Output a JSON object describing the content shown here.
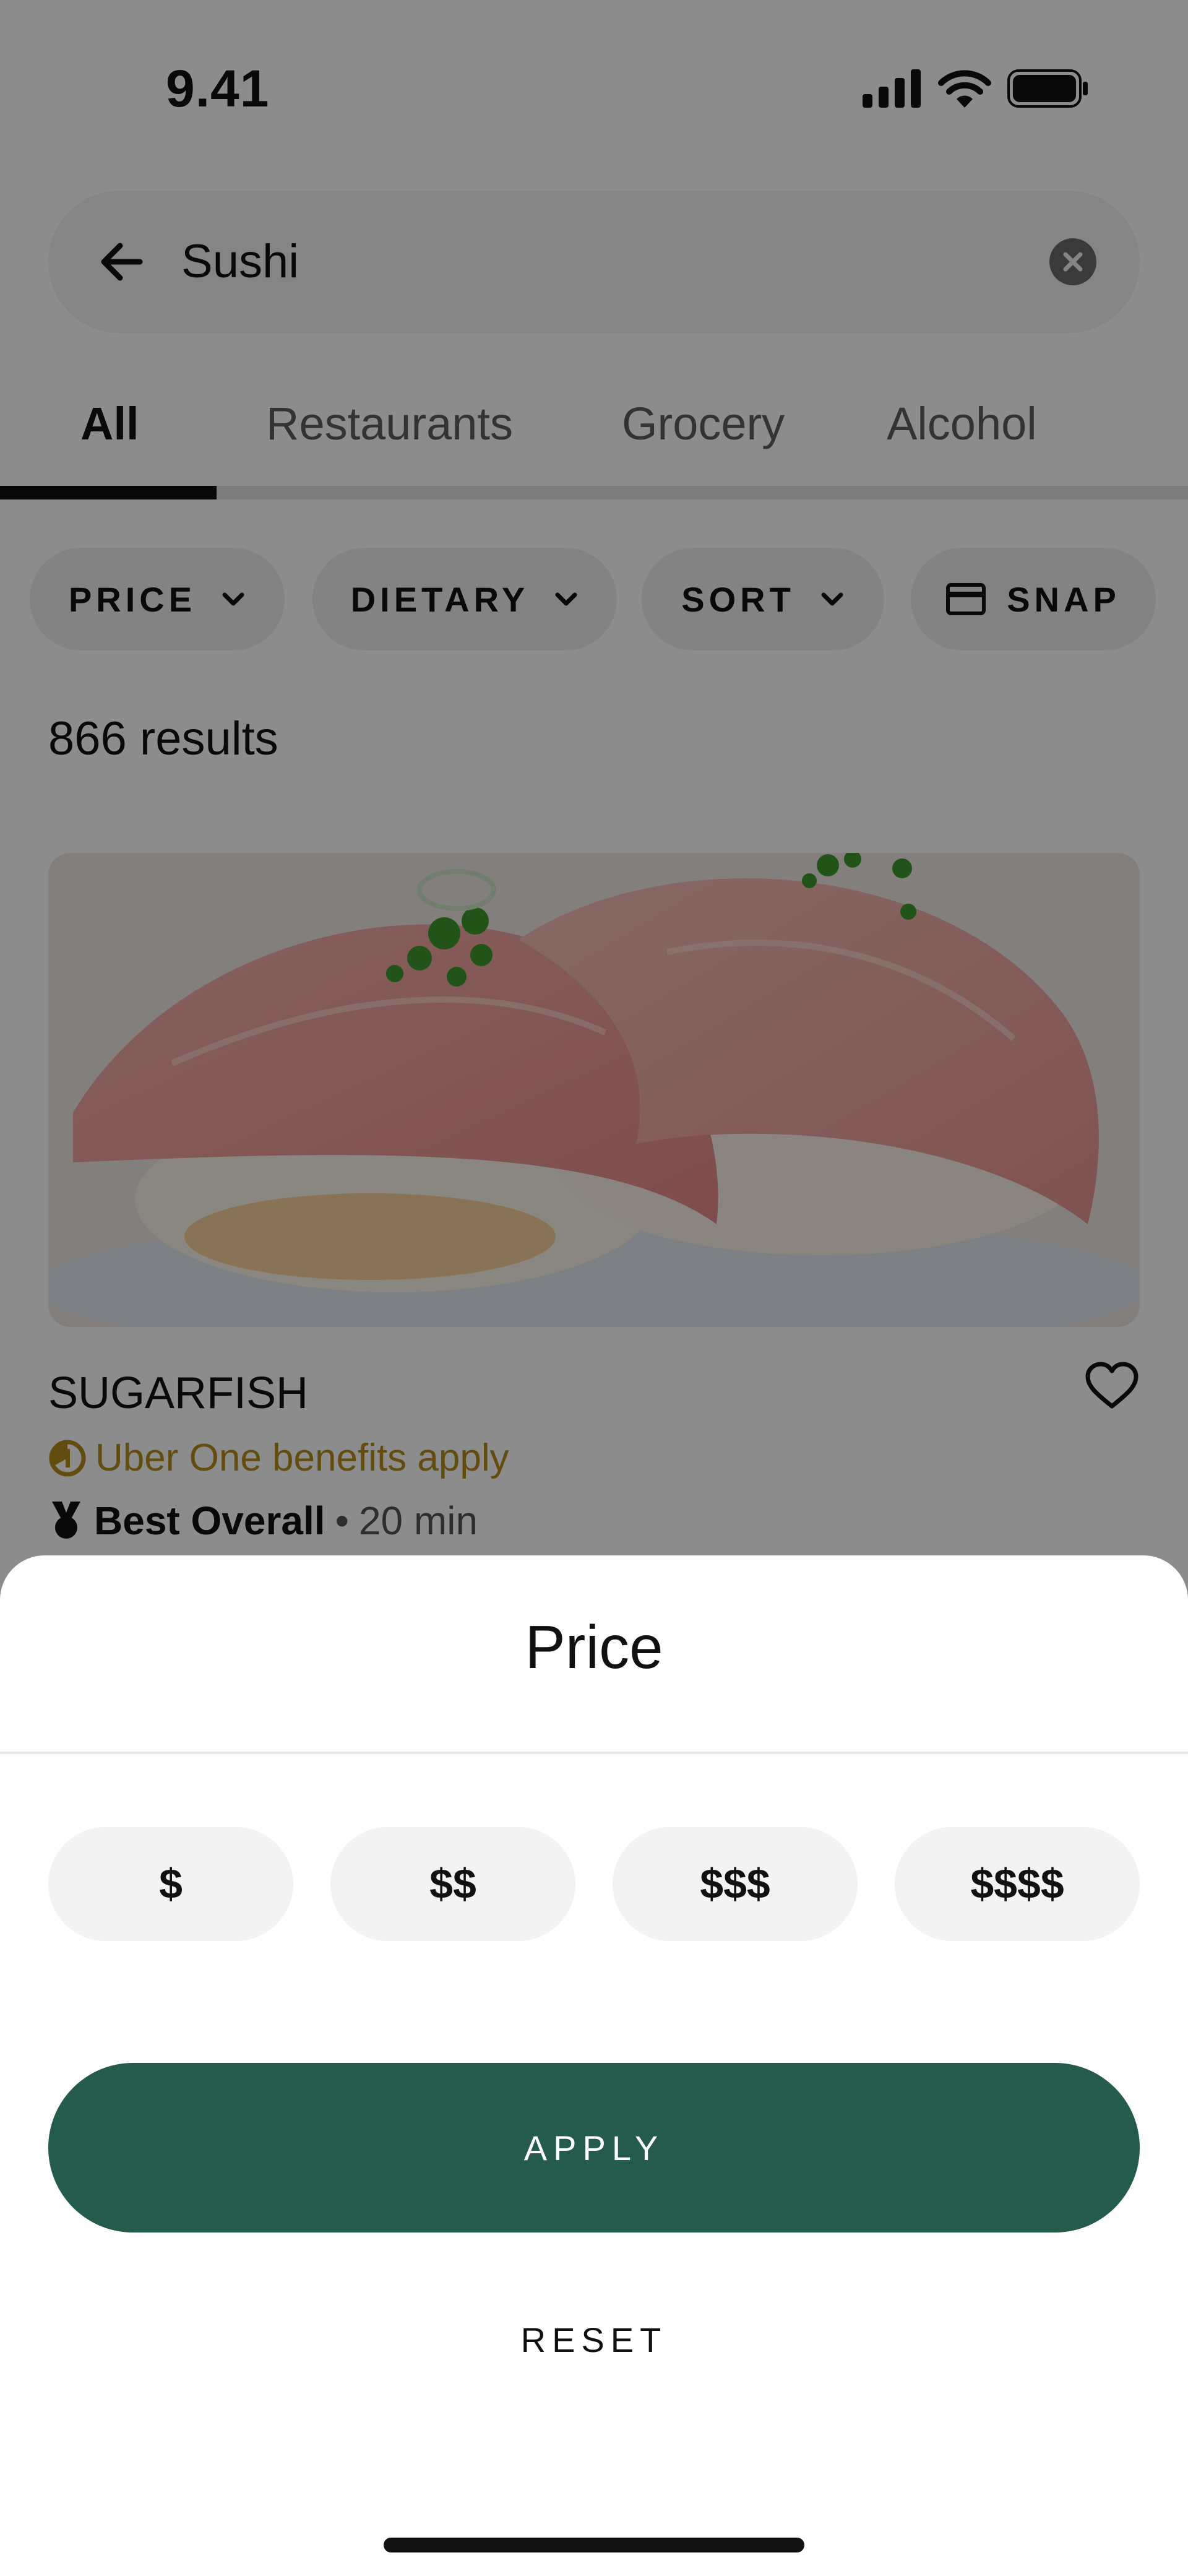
{
  "status_bar": {
    "time": "9.41",
    "icons": [
      "signal-icon",
      "wifi-icon",
      "battery-icon"
    ]
  },
  "search": {
    "query": "Sushi",
    "back_icon": "arrow-left-icon",
    "clear_icon": "clear-icon"
  },
  "tabs": [
    {
      "label": "All",
      "active": true
    },
    {
      "label": "Restaurants",
      "active": false
    },
    {
      "label": "Grocery",
      "active": false
    },
    {
      "label": "Alcohol",
      "active": false
    }
  ],
  "filters": [
    {
      "label": "PRICE",
      "icon": "chevron-down-icon"
    },
    {
      "label": "DIETARY",
      "icon": "chevron-down-icon"
    },
    {
      "label": "SORT",
      "icon": "chevron-down-icon"
    },
    {
      "label": "SNAP",
      "icon": "card-icon"
    }
  ],
  "results": {
    "count_label": "866 results"
  },
  "store": {
    "name": "SUGARFISH",
    "benefits": "Uber One benefits apply",
    "badge": "Best Overall",
    "separator": "•",
    "eta": "20 min"
  },
  "sheet": {
    "title": "Price",
    "options": [
      "$",
      "$$",
      "$$$",
      "$$$$"
    ],
    "apply_label": "APPLY",
    "reset_label": "RESET"
  },
  "colors": {
    "primary_button": "#245b4c",
    "benefits_gold": "#b38a1e",
    "chip_bg": "#eeeeee",
    "overlay": "rgba(0,0,0,0.45)"
  }
}
